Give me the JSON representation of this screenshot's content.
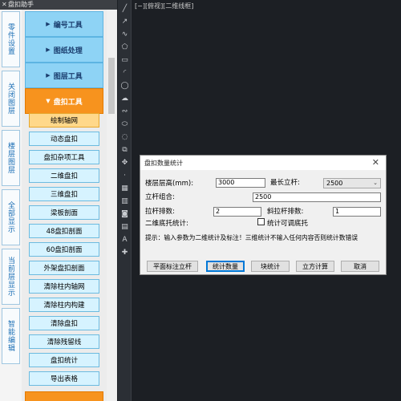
{
  "panel": {
    "title": "盘扣助手",
    "vtabs": [
      "零件设置",
      "关闭图层",
      "楼层图层",
      "全部显示",
      "当前层显示",
      "智能编辑"
    ],
    "groups": [
      {
        "label": "编号工具",
        "arrow": "▶"
      },
      {
        "label": "图纸处理",
        "arrow": "▶"
      },
      {
        "label": "图层工具",
        "arrow": "▶"
      },
      {
        "label": "盘扣工具",
        "arrow": "▼"
      }
    ],
    "buttons": [
      "绘制轴网",
      "动态盘扣",
      "盘扣杂项工具",
      "二维盘扣",
      "三维盘扣",
      "梁板剖面",
      "48盘扣剖面",
      "60盘扣剖面",
      "外架盘扣剖面",
      "清除柱内轴网",
      "清除柱内构建",
      "清除盘扣",
      "清除残留线",
      "盘扣统计",
      "导出表格"
    ]
  },
  "toolbar": {
    "icons": [
      "line-icon",
      "polyline-icon",
      "spline-icon",
      "polygon-icon",
      "rectangle-icon",
      "arc-icon",
      "circle-icon",
      "revcloud-icon",
      "spline-curve-icon",
      "ellipse-icon",
      "ellipse-arc-icon",
      "insert-block-icon",
      "make-block-icon",
      "point-icon",
      "hatch-icon",
      "gradient-icon",
      "region-icon",
      "table-icon",
      "text-icon",
      "add-selected-icon"
    ],
    "glyphs": [
      "╱",
      "↗",
      "∿",
      "⬠",
      "▭",
      "◜",
      "◯",
      "☁",
      "∾",
      "⬭",
      "◌",
      "⧉",
      "✥",
      "·",
      "▦",
      "▥",
      "◙",
      "▤",
      "A",
      "✚"
    ]
  },
  "canvas": {
    "view_label": "[−][俯视][二维线框]"
  },
  "dialog": {
    "title": "盘扣数量统计",
    "close": "✕",
    "floor_height_label": "楼层层高(mm):",
    "floor_height_value": "3000",
    "max_pole_label": "最长立杆:",
    "max_pole_value": "2500",
    "pole_combo_label": "立杆组合:",
    "pole_combo_value": "2500",
    "tie_rows_label": "拉杆排数:",
    "tie_rows_value": "2",
    "diag_rows_label": "斜拉杆排数:",
    "diag_rows_value": "1",
    "base_stat_label": "二维底托统计:",
    "adjustable_base_label": "统计可调底托",
    "hint": "提示：输入参数为二维统计及标注！三维统计不输入任何内容否则统计数错误",
    "buttons": [
      "平面标注立杆",
      "统计数量",
      "块统计",
      "立方计算",
      "取消"
    ]
  }
}
